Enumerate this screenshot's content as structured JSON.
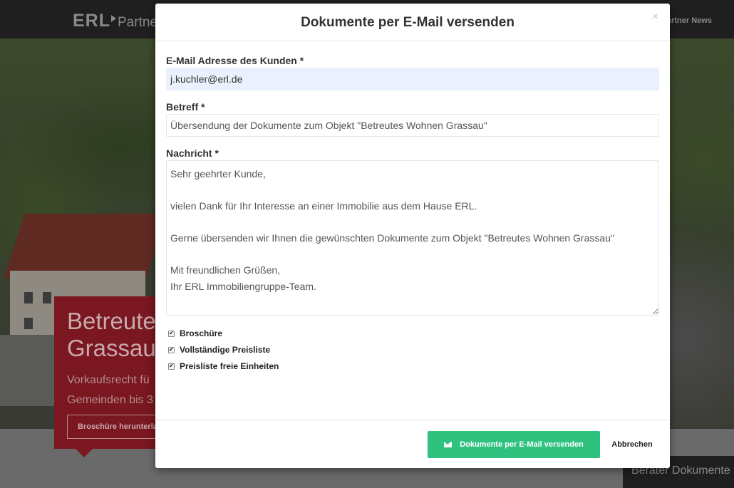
{
  "background": {
    "logo": "ERL",
    "logo_sub": "Partner",
    "nav_link": "artner News",
    "promo_title": "Betreute\nGrassau",
    "promo_text": "Vorkaufsrecht fü\nGemeinden bis 3",
    "promo_button": "Broschüre herunterla",
    "berater_tab": "Berater Dokumente"
  },
  "modal": {
    "title": "Dokumente per E-Mail versenden",
    "close_symbol": "×",
    "email": {
      "label": "E-Mail Adresse des Kunden *",
      "value": "j.kuchler@erl.de"
    },
    "subject": {
      "label": "Betreff *",
      "value": "Übersendung der Dokumente zum Objekt \"Betreutes Wohnen Grassau\""
    },
    "message": {
      "label": "Nachricht *",
      "value": "Sehr geehrter Kunde,\n\nvielen Dank für Ihr Interesse an einer Immobilie aus dem Hause ERL.\n\nGerne übersenden wir Ihnen die gewünschten Dokumente zum Objekt \"Betreutes Wohnen Grassau\"\n\nMit freundlichen Grüßen,\nIhr ERL Immobiliengruppe-Team."
    },
    "documents": [
      {
        "label": "Broschüre",
        "checked": true
      },
      {
        "label": "Vollständige Preisliste",
        "checked": true
      },
      {
        "label": "Preisliste freie Einheiten",
        "checked": true
      }
    ],
    "check_mark": "✔",
    "send_button": "Dokumente per E-Mail versenden",
    "cancel_button": "Abbrechen"
  },
  "colors": {
    "primary_button": "#2ec27e",
    "autofill_bg": "#eaf0fd",
    "promo_red": "#7a1720"
  },
  "icons": {
    "send": "mail-icon",
    "close": "close-icon"
  }
}
